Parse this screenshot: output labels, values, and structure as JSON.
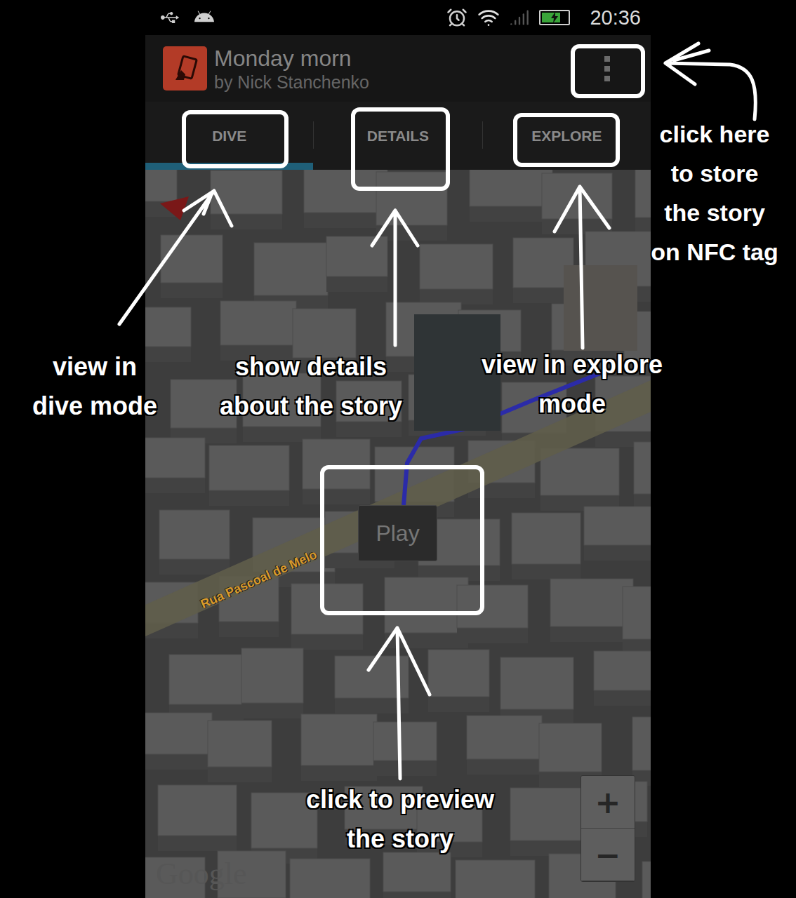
{
  "status_bar": {
    "time": "20:36",
    "battery": {
      "level": 0.7,
      "charging": true
    }
  },
  "action_bar": {
    "title": "Monday morn",
    "subtitle": "by Nick Stanchenko"
  },
  "tabs": [
    {
      "label": "DIVE",
      "selected": true
    },
    {
      "label": "DETAILS",
      "selected": false
    },
    {
      "label": "EXPLORE",
      "selected": false
    }
  ],
  "map": {
    "street": "Rua Pascoal de Melo",
    "play_button": "Play",
    "zoom_in": "+",
    "zoom_out": "−",
    "attribution": "Google"
  },
  "annotations": [
    {
      "lines": [
        "view in",
        "dive mode"
      ]
    },
    {
      "lines": [
        "show details",
        "about the story"
      ]
    },
    {
      "lines": [
        "view in explore",
        "mode"
      ]
    },
    {
      "lines": [
        "click here",
        "to store",
        "the story",
        "on NFC tag"
      ]
    },
    {
      "lines": [
        "click to preview",
        "the story"
      ]
    }
  ]
}
